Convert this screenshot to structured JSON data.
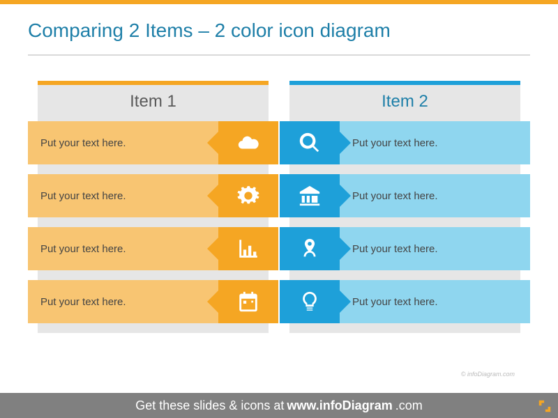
{
  "title": "Comparing 2 Items – 2 color icon diagram",
  "columns": {
    "left": {
      "heading": "Item 1",
      "rows": [
        {
          "text": "Put your text here.",
          "icon": "cloud-icon"
        },
        {
          "text": "Put your text here.",
          "icon": "gears-icon"
        },
        {
          "text": "Put your text here.",
          "icon": "bar-chart-icon"
        },
        {
          "text": "Put your text here.",
          "icon": "calendar-icon"
        }
      ]
    },
    "right": {
      "heading": "Item 2",
      "rows": [
        {
          "text": "Put your text here.",
          "icon": "magnifier-icon"
        },
        {
          "text": "Put your text here.",
          "icon": "bank-icon"
        },
        {
          "text": "Put your text here.",
          "icon": "target-pin-icon"
        },
        {
          "text": "Put your text here.",
          "icon": "lightbulb-icon"
        }
      ]
    }
  },
  "watermark": "© infoDiagram.com",
  "footer": {
    "prefix": "Get these slides & icons at ",
    "emph": "www.infoDiagram",
    "suffix": ".com"
  }
}
